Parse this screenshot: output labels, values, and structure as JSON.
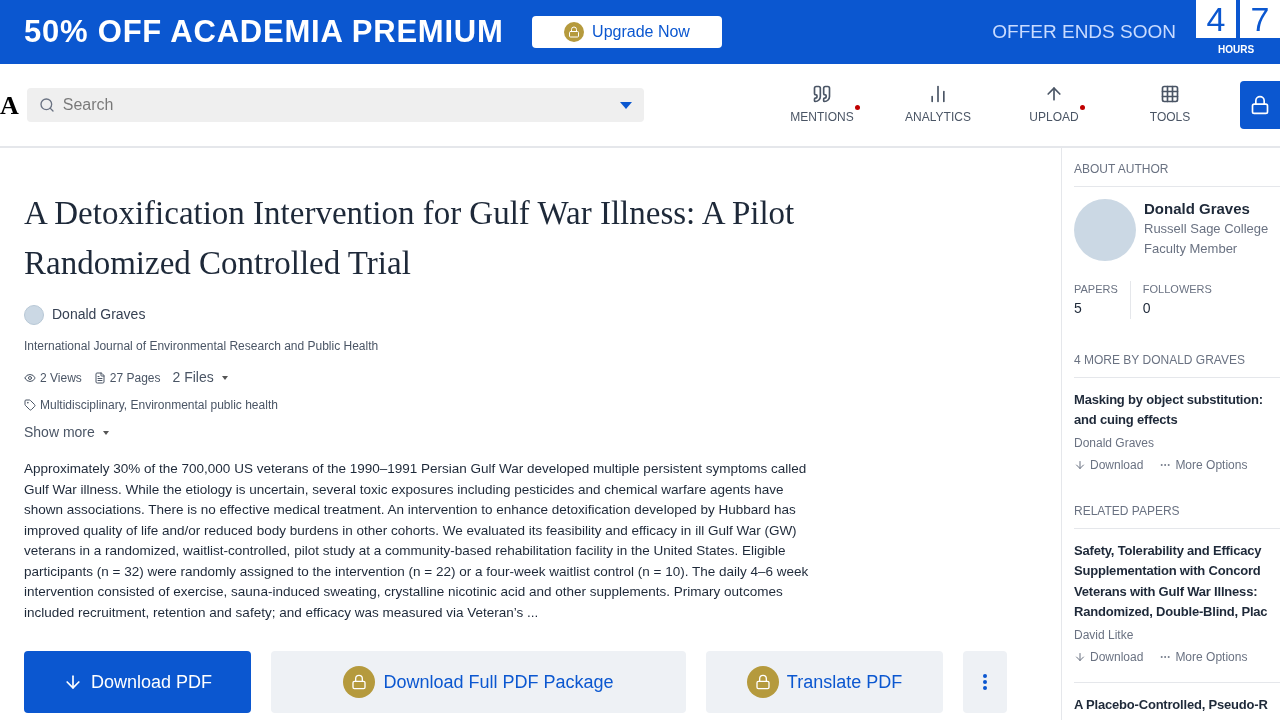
{
  "banner": {
    "headline": "50% OFF ACADEMIA PREMIUM",
    "upgrade_button": "Upgrade Now",
    "offer_text": "OFFER ENDS SOON",
    "countdown_digits": [
      "4",
      "7"
    ],
    "countdown_unit": "HOURS"
  },
  "nav": {
    "logo": "A",
    "search": {
      "placeholder": "Search"
    },
    "items": [
      {
        "label": "MENTIONS",
        "kind": "mentions",
        "notification": true
      },
      {
        "label": "ANALYTICS",
        "kind": "analytics",
        "notification": false
      },
      {
        "label": "UPLOAD",
        "kind": "upload",
        "notification": true
      },
      {
        "label": "TOOLS",
        "kind": "tools",
        "notification": false
      }
    ]
  },
  "paper": {
    "title": "A Detoxification Intervention for Gulf War Illness: A Pilot Randomized Controlled Trial",
    "author": "Donald Graves",
    "journal": "International Journal of Environmental Research and Public Health",
    "views": "2 Views",
    "pages": "27 Pages",
    "files": "2 Files",
    "tags": "Multidisciplinary, Environmental public health",
    "show_more": "Show more",
    "abstract": "Approximately 30% of the 700,000 US veterans of the 1990–1991 Persian Gulf War developed multiple persistent symptoms called Gulf War illness. While the etiology is uncertain, several toxic exposures including pesticides and chemical warfare agents have shown associations. There is no effective medical treatment. An intervention to enhance detoxification developed by Hubbard has improved quality of life and/or reduced body burdens in other cohorts. We evaluated its feasibility and efficacy in ill Gulf War (GW) veterans in a randomized, waitlist-controlled, pilot study at a community-based rehabilitation facility in the United States. Eligible participants (n = 32) were randomly assigned to the intervention (n = 22) or a four-week waitlist control (n = 10). The daily 4–6 week intervention consisted of exercise, sauna-induced sweating, crystalline nicotinic acid and other supplements. Primary outcomes included recruitment, retention and safety; and efficacy was measured via Veteran’s ...",
    "actions": [
      {
        "label": "Download PDF",
        "kind": "primary"
      },
      {
        "label": "Download Full PDF Package",
        "kind": "locked"
      },
      {
        "label": "Translate PDF",
        "kind": "locked"
      }
    ]
  },
  "sidebar": {
    "about_heading": "ABOUT AUTHOR",
    "author_name": "Donald Graves",
    "affiliation": "Russell Sage College",
    "role": "Faculty Member",
    "stats": [
      {
        "label": "PAPERS",
        "value": "5"
      },
      {
        "label": "FOLLOWERS",
        "value": "0"
      }
    ],
    "more_heading": "4 MORE BY DONALD GRAVES",
    "more_papers": [
      {
        "title_lines": [
          "Masking by object substitution:",
          "and cuing effects"
        ],
        "author": "Donald Graves",
        "download": "Download",
        "more_options": "More Options"
      }
    ],
    "related_heading": "RELATED PAPERS",
    "related_papers": [
      {
        "title_lines": [
          "Safety, Tolerability and Efficacy",
          "Supplementation with Concord",
          "Veterans with Gulf War Illness:",
          "Randomized, Double-Blind, Plac"
        ],
        "author": "David Litke",
        "download": "Download",
        "more_options": "More Options"
      },
      {
        "title_lines": [
          "A Placebo-Controlled, Pseudo-R"
        ]
      }
    ]
  }
}
